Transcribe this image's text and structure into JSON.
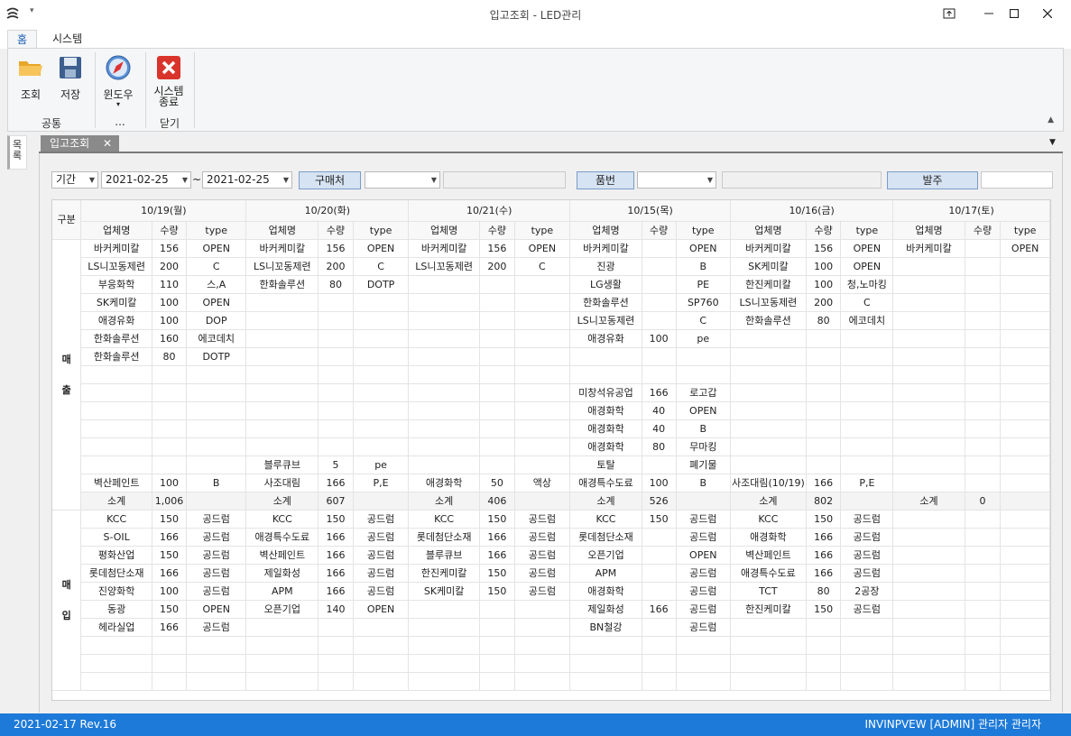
{
  "window": {
    "title": "입고조회 - LED관리",
    "qa_arrow": "▾"
  },
  "ribbon": {
    "tabs": [
      {
        "label": "홈"
      },
      {
        "label": "시스템"
      }
    ],
    "buttons": {
      "search": "조회",
      "save": "저장",
      "window": "윈도우",
      "window_arrow": "▾",
      "exit_line1": "시스템",
      "exit_line2": "종료"
    },
    "groups": {
      "common": "공통",
      "window": "...",
      "close": "닫기"
    }
  },
  "sidebar": {
    "label": "목록"
  },
  "doc_tab": {
    "label": "입고조회",
    "close": "✕"
  },
  "filters": {
    "period_label": "기간",
    "date_from": "2021-02-25",
    "tilde": "~",
    "date_to": "2021-02-25",
    "buyer_button": "구매처",
    "buyer_value": "",
    "item_button": "품번",
    "item_value": "",
    "order_button": "발주"
  },
  "grid": {
    "category_header": "구분",
    "days": [
      "10/19(월)",
      "10/20(화)",
      "10/21(수)",
      "10/15(목)",
      "10/16(금)",
      "10/17(토)"
    ],
    "sub_headers": [
      "업체명",
      "수량",
      "type"
    ],
    "sections": [
      {
        "label": "매\n출",
        "label_a": "매",
        "label_b": "출",
        "rows": [
          [
            "바커케미칼",
            "156",
            "OPEN",
            "바커케미칼",
            "156",
            "OPEN",
            "바커케미칼",
            "156",
            "OPEN",
            "바커케미칼",
            "",
            "OPEN",
            "바커케미칼",
            "156",
            "OPEN",
            "바커케미칼",
            "",
            "OPEN"
          ],
          [
            "LS니꼬동제련",
            "200",
            "C",
            "LS니꼬동제련",
            "200",
            "C",
            "LS니꼬동제련",
            "200",
            "C",
            "진광",
            "",
            "B",
            "SK케미칼",
            "100",
            "OPEN",
            "",
            "",
            ""
          ],
          [
            "부응화학",
            "110",
            "스,A",
            "한화솔루션",
            "80",
            "DOTP",
            "",
            "",
            "",
            "LG생활",
            "",
            "PE",
            "한진케미칼",
            "100",
            "청,노마킹",
            "",
            "",
            ""
          ],
          [
            "SK케미칼",
            "100",
            "OPEN",
            "",
            "",
            "",
            "",
            "",
            "",
            "한화솔루션",
            "",
            "SP760",
            "LS니꼬동제련",
            "200",
            "C",
            "",
            "",
            ""
          ],
          [
            "애경유화",
            "100",
            "DOP",
            "",
            "",
            "",
            "",
            "",
            "",
            "LS니꼬동제련",
            "",
            "C",
            "한화솔루션",
            "80",
            "에코데치",
            "",
            "",
            ""
          ],
          [
            "한화솔루션",
            "160",
            "에코데치",
            "",
            "",
            "",
            "",
            "",
            "",
            "애경유화",
            "100",
            "pe",
            "",
            "",
            "",
            "",
            "",
            ""
          ],
          [
            "한화솔루션",
            "80",
            "DOTP",
            "",
            "",
            "",
            "",
            "",
            "",
            "",
            "",
            "",
            "",
            "",
            "",
            "",
            "",
            ""
          ],
          [
            "",
            "",
            "",
            "",
            "",
            "",
            "",
            "",
            "",
            "",
            "",
            "",
            "",
            "",
            "",
            "",
            "",
            ""
          ],
          [
            "",
            "",
            "",
            "",
            "",
            "",
            "",
            "",
            "",
            "미창석유공업",
            "166",
            "로고갑",
            "",
            "",
            "",
            "",
            "",
            ""
          ],
          [
            "",
            "",
            "",
            "",
            "",
            "",
            "",
            "",
            "",
            "애경화학",
            "40",
            "OPEN",
            "",
            "",
            "",
            "",
            "",
            ""
          ],
          [
            "",
            "",
            "",
            "",
            "",
            "",
            "",
            "",
            "",
            "애경화학",
            "40",
            "B",
            "",
            "",
            "",
            "",
            "",
            ""
          ],
          [
            "",
            "",
            "",
            "",
            "",
            "",
            "",
            "",
            "",
            "애경화학",
            "80",
            "무마킹",
            "",
            "",
            "",
            "",
            "",
            ""
          ],
          [
            "",
            "",
            "",
            "블루큐브",
            "5",
            "pe",
            "",
            "",
            "",
            "토탈",
            "",
            "폐기물",
            "",
            "",
            "",
            "",
            "",
            ""
          ],
          [
            "벽산페인트",
            "100",
            "B",
            "사조대림",
            "166",
            "P,E",
            "애경화학",
            "50",
            "액상",
            "애경특수도료",
            "100",
            "B",
            "사조대림(10/19)",
            "166",
            "P,E",
            "",
            "",
            ""
          ]
        ],
        "subtotal": [
          "소계",
          "1,006",
          "",
          "소계",
          "607",
          "",
          "소계",
          "406",
          "",
          "소계",
          "526",
          "",
          "소계",
          "802",
          "",
          "소계",
          "0",
          ""
        ]
      },
      {
        "label": "매\n입",
        "label_a": "매",
        "label_b": "입",
        "rows": [
          [
            "KCC",
            "150",
            "공드럼",
            "KCC",
            "150",
            "공드럼",
            "KCC",
            "150",
            "공드럼",
            "KCC",
            "150",
            "공드럼",
            "KCC",
            "150",
            "공드럼",
            "",
            "",
            ""
          ],
          [
            "S-OIL",
            "166",
            "공드럼",
            "애경특수도료",
            "166",
            "공드럼",
            "롯데첨단소재",
            "166",
            "공드럼",
            "롯데첨단소재",
            "",
            "공드럼",
            "애경화학",
            "166",
            "공드럼",
            "",
            "",
            ""
          ],
          [
            "평화산업",
            "150",
            "공드럼",
            "벽산페인트",
            "166",
            "공드럼",
            "블루큐브",
            "166",
            "공드럼",
            "오픈기업",
            "",
            "OPEN",
            "벽산페인트",
            "166",
            "공드럼",
            "",
            "",
            ""
          ],
          [
            "롯데첨단소재",
            "166",
            "공드럼",
            "제일화성",
            "166",
            "공드럼",
            "한진케미칼",
            "150",
            "공드럼",
            "APM",
            "",
            "공드럼",
            "애경특수도료",
            "166",
            "공드럼",
            "",
            "",
            ""
          ],
          [
            "진양화학",
            "100",
            "공드럼",
            "APM",
            "166",
            "공드럼",
            "SK케미칼",
            "150",
            "공드럼",
            "애경화학",
            "",
            "공드럼",
            "TCT",
            "80",
            "2공장",
            "",
            "",
            ""
          ],
          [
            "동광",
            "150",
            "OPEN",
            "오픈기업",
            "140",
            "OPEN",
            "",
            "",
            "",
            "제일화성",
            "166",
            "공드럼",
            "한진케미칼",
            "150",
            "공드럼",
            "",
            "",
            ""
          ],
          [
            "헤라실업",
            "166",
            "공드럼",
            "",
            "",
            "",
            "",
            "",
            "",
            "BN철강",
            "",
            "공드럼",
            "",
            "",
            "",
            "",
            "",
            ""
          ],
          [
            "",
            "",
            "",
            "",
            "",
            "",
            "",
            "",
            "",
            "",
            "",
            "",
            "",
            "",
            "",
            "",
            "",
            ""
          ],
          [
            "",
            "",
            "",
            "",
            "",
            "",
            "",
            "",
            "",
            "",
            "",
            "",
            "",
            "",
            "",
            "",
            "",
            ""
          ],
          [
            "",
            "",
            "",
            "",
            "",
            "",
            "",
            "",
            "",
            "",
            "",
            "",
            "",
            "",
            "",
            "",
            "",
            ""
          ]
        ]
      }
    ]
  },
  "status": {
    "left": "2021-02-17 Rev.16",
    "right": "INVINPVEW   [ADMIN] 관리자 관리자"
  },
  "colors": {
    "accent": "#1d7ad8",
    "button_bg": "#d6e3f3",
    "tab_active": "#8a8a8a"
  }
}
